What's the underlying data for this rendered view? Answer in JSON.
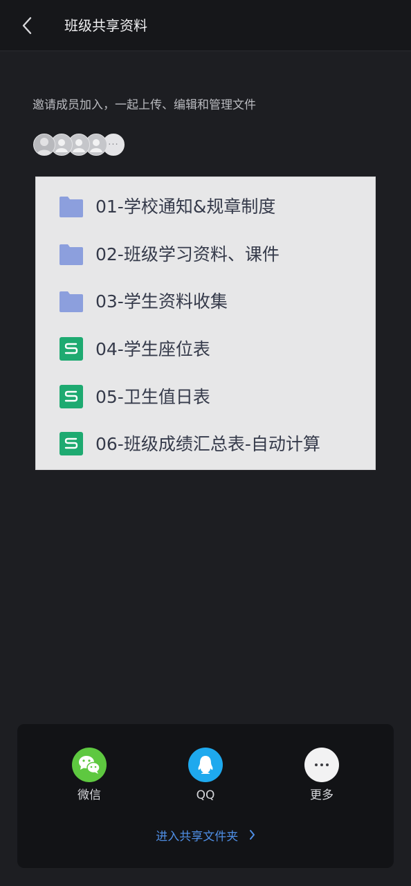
{
  "header": {
    "title": "班级共享资料",
    "back_icon": "chevron-left-icon"
  },
  "invite": {
    "text": "邀请成员加入，一起上传、编辑和管理文件",
    "more_label": "···"
  },
  "files": [
    {
      "name": "01-学校通知&规章制度",
      "type": "folder",
      "icon": "folder-icon",
      "color": "#8c9fdd"
    },
    {
      "name": "02-班级学习资料、课件",
      "type": "folder",
      "icon": "folder-icon",
      "color": "#8c9fdd"
    },
    {
      "name": "03-学生资料收集",
      "type": "folder",
      "icon": "folder-icon",
      "color": "#8c9fdd"
    },
    {
      "name": "04-学生座位表",
      "type": "sheet",
      "icon": "spreadsheet-icon",
      "color": "#1eaa71"
    },
    {
      "name": "05-卫生值日表",
      "type": "sheet",
      "icon": "spreadsheet-icon",
      "color": "#1eaa71"
    },
    {
      "name": "06-班级成绩汇总表-自动计算",
      "type": "sheet",
      "icon": "spreadsheet-icon",
      "color": "#1eaa71"
    }
  ],
  "share": {
    "wechat_label": "微信",
    "qq_label": "QQ",
    "more_label": "更多",
    "enter_label": "进入共享文件夹",
    "colors": {
      "wechat": "#5ec840",
      "qq": "#1ea9ee",
      "more": "#f2f2f3",
      "link": "#4f8fe6"
    }
  }
}
